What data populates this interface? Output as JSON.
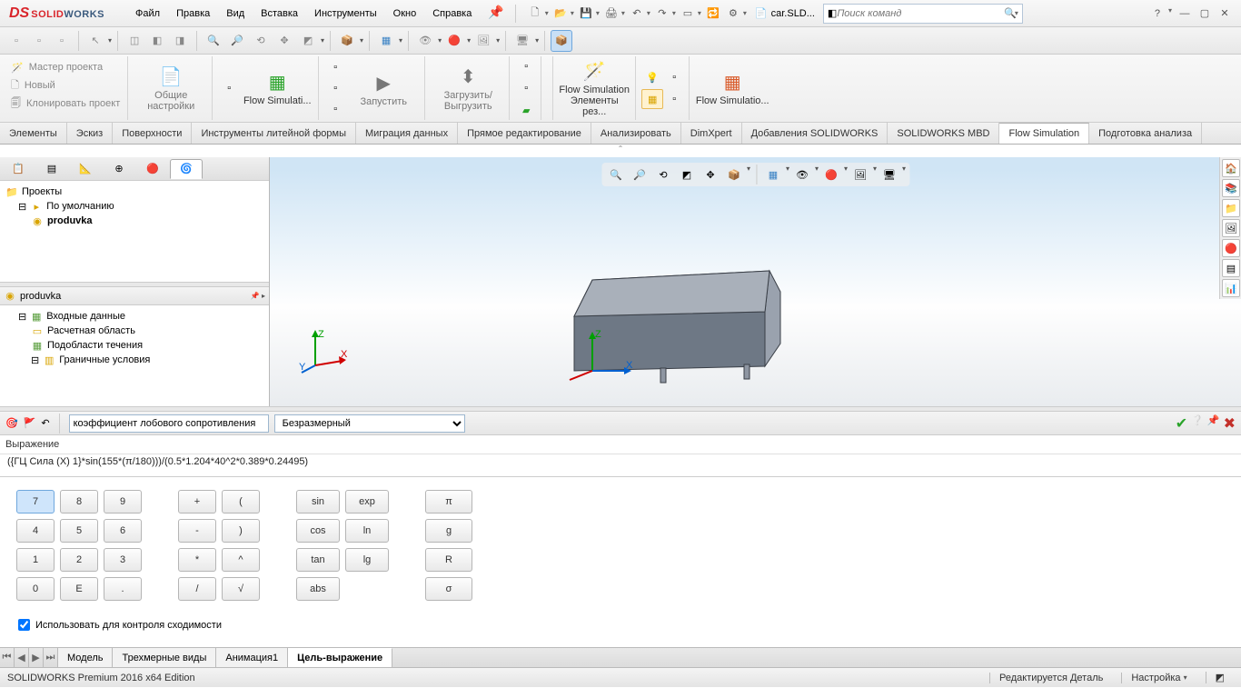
{
  "app": {
    "name_solid": "SOLID",
    "name_works": "WORKS"
  },
  "menu": [
    "Файл",
    "Правка",
    "Вид",
    "Вставка",
    "Инструменты",
    "Окно",
    "Справка"
  ],
  "titlebar": {
    "file_label": "car.SLD...",
    "search_placeholder": "Поиск команд"
  },
  "toolbar2_icons": [
    "⬚",
    "⬚",
    "⬚",
    "↖",
    "⊞",
    "⧉",
    "⤢",
    "🔍",
    "🔍",
    "⟲",
    "⬚",
    "📦",
    "📦",
    "📦",
    "📦",
    "👁",
    "⬚",
    "⬚",
    "🖥",
    "📦"
  ],
  "ribbon": {
    "left_items": [
      "Мастер проекта",
      "Новый",
      "Клонировать проект"
    ],
    "general": "Общие настройки",
    "flowsim": "Flow Simulati...",
    "run": "Запустить",
    "load": "Загрузить/Выгрузить",
    "flowsim2": "Flow Simulation Элементы рез...",
    "flowsim3": "Flow Simulatio..."
  },
  "cmdtabs": [
    "Элементы",
    "Эскиз",
    "Поверхности",
    "Инструменты литейной формы",
    "Миграция данных",
    "Прямое редактирование",
    "Анализировать",
    "DimXpert",
    "Добавления SOLIDWORKS",
    "SOLIDWORKS MBD",
    "Flow Simulation",
    "Подготовка анализа"
  ],
  "tree1": {
    "root": "Проекты",
    "default": "По умолчанию",
    "study": "produvka"
  },
  "tree2": {
    "root": "produvka",
    "items": [
      "Входные данные",
      "Расчетная область",
      "Подобласти течения",
      "Граничные условия"
    ]
  },
  "eq": {
    "name": "коэффициент лобового сопротивления",
    "unit": "Безразмерный",
    "expr_label": "Выражение",
    "expr": "({ГЦ Сила (X) 1}*sin(155*(π/180)))/(0.5*1.204*40^2*0.389*0.24495)",
    "convergence": "Использовать для контроля сходимости"
  },
  "keypad": {
    "nums": [
      "7",
      "8",
      "9",
      "4",
      "5",
      "6",
      "1",
      "2",
      "3",
      "0",
      "E",
      "."
    ],
    "ops": [
      "+",
      "(",
      "-",
      ")",
      "*",
      "^",
      "/",
      "√"
    ],
    "funcs": [
      "sin",
      "exp",
      "cos",
      "ln",
      "tan",
      "lg",
      "abs",
      ""
    ],
    "consts": [
      "π",
      "g",
      "R",
      "σ"
    ]
  },
  "bottom_tabs": [
    "Модель",
    "Трехмерные виды",
    "Анимация1",
    "Цель-выражение"
  ],
  "status": {
    "left": "SOLIDWORKS Premium 2016 x64 Edition",
    "edit": "Редактируется Деталь",
    "custom": "Настройка"
  }
}
